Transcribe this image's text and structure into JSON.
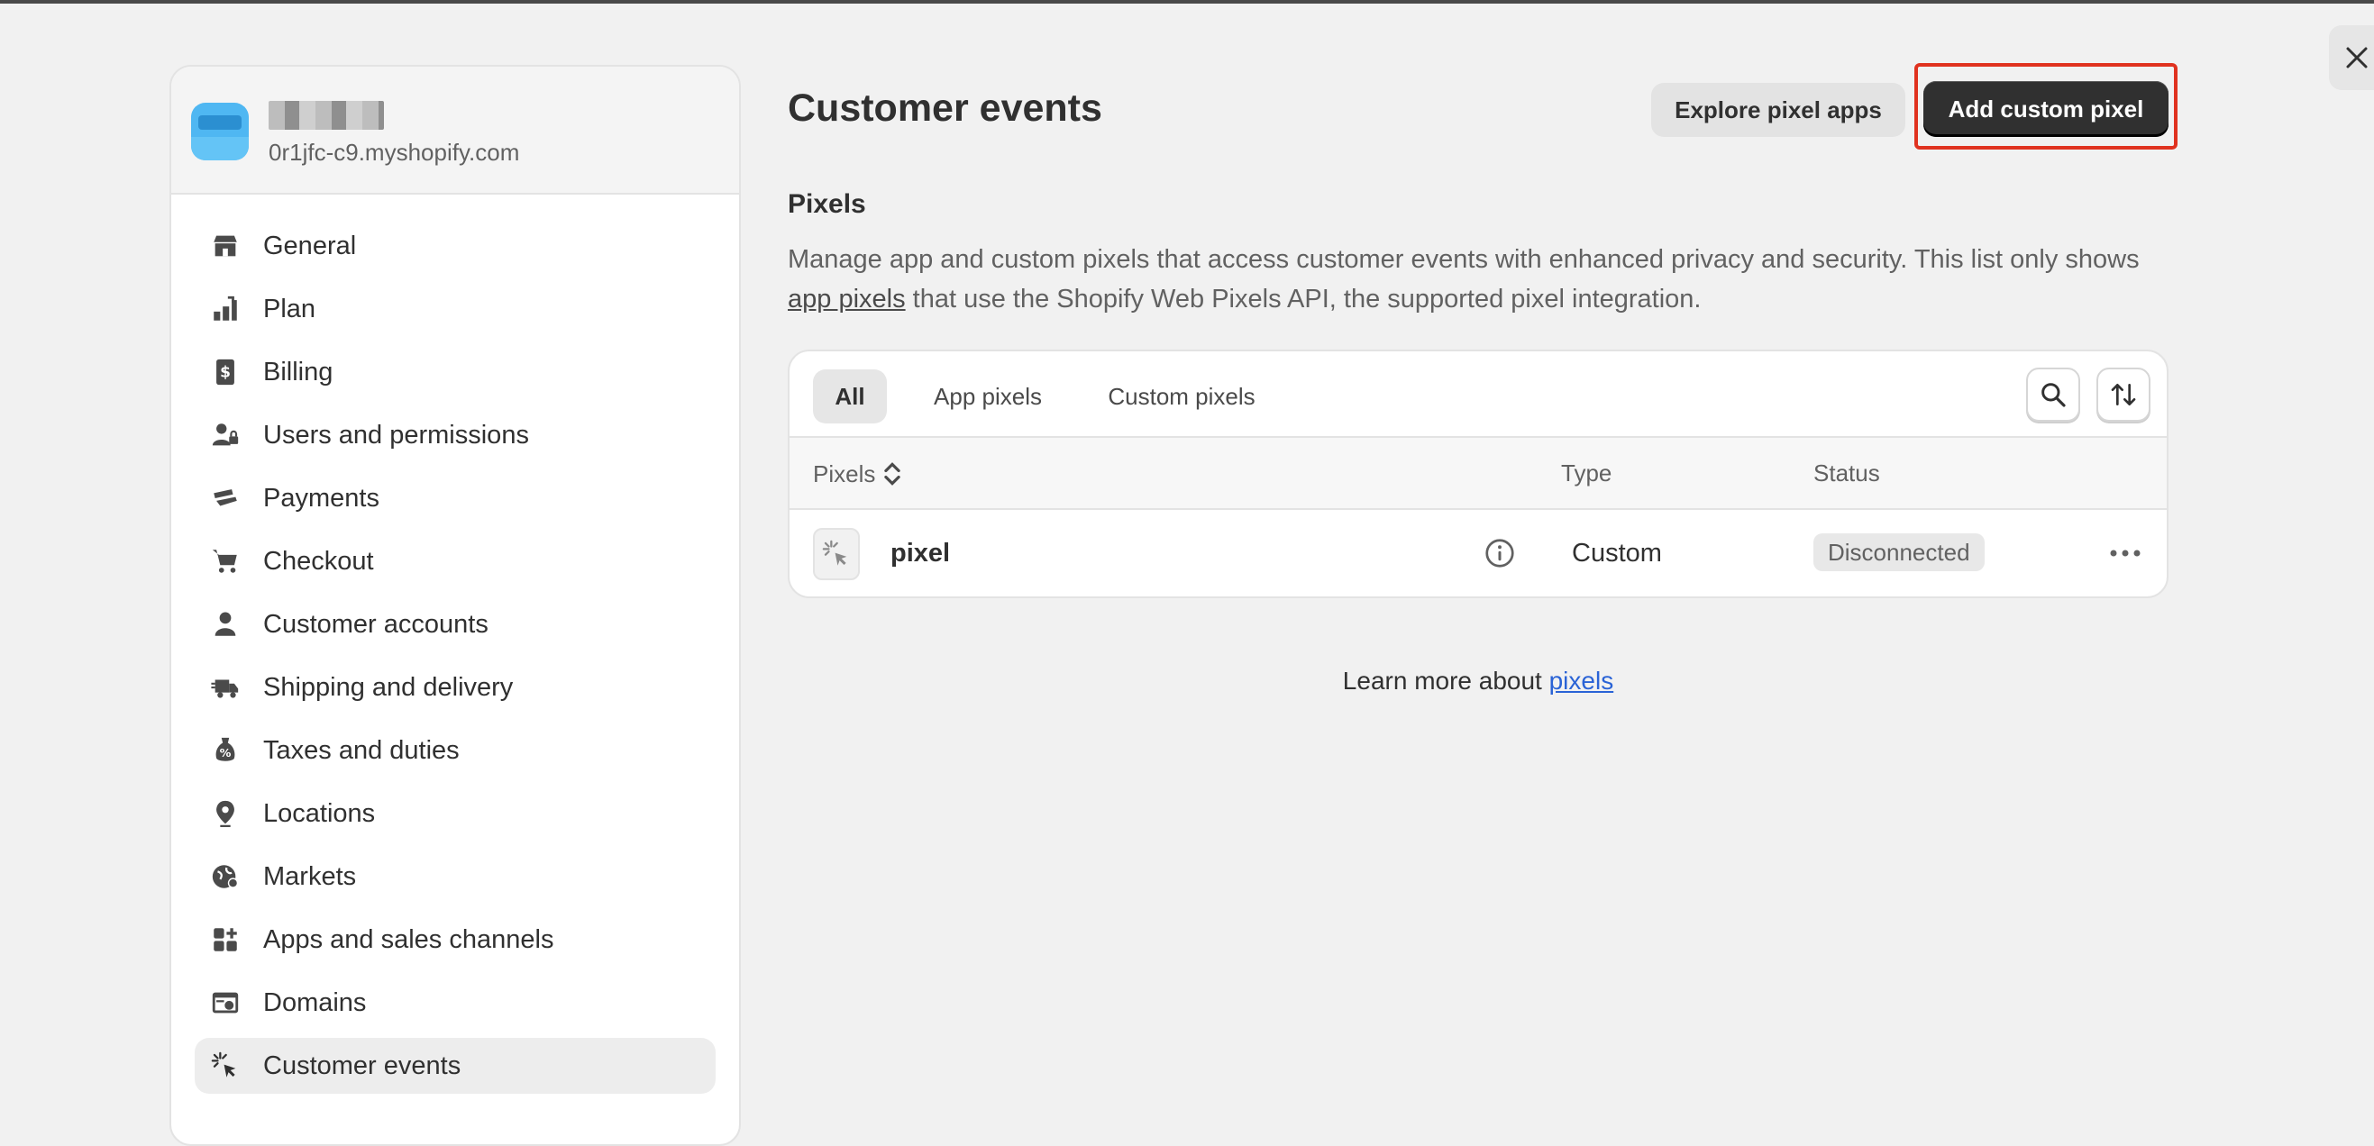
{
  "window": {
    "close_icon": "close-icon"
  },
  "store": {
    "name": "",
    "domain": "0r1jfc-c9.myshopify.com"
  },
  "sidebar": {
    "items": [
      {
        "label": "General",
        "icon": "store-icon",
        "active": false
      },
      {
        "label": "Plan",
        "icon": "plan-icon",
        "active": false
      },
      {
        "label": "Billing",
        "icon": "billing-icon",
        "active": false
      },
      {
        "label": "Users and permissions",
        "icon": "users-icon",
        "active": false
      },
      {
        "label": "Payments",
        "icon": "payments-icon",
        "active": false
      },
      {
        "label": "Checkout",
        "icon": "cart-icon",
        "active": false
      },
      {
        "label": "Customer accounts",
        "icon": "person-icon",
        "active": false
      },
      {
        "label": "Shipping and delivery",
        "icon": "truck-icon",
        "active": false
      },
      {
        "label": "Taxes and duties",
        "icon": "tax-icon",
        "active": false
      },
      {
        "label": "Locations",
        "icon": "location-pin-icon",
        "active": false
      },
      {
        "label": "Markets",
        "icon": "globe-icon",
        "active": false
      },
      {
        "label": "Apps and sales channels",
        "icon": "apps-icon",
        "active": false
      },
      {
        "label": "Domains",
        "icon": "domains-icon",
        "active": false
      },
      {
        "label": "Customer events",
        "icon": "cursor-click-icon",
        "active": true
      }
    ]
  },
  "main": {
    "title": "Customer events",
    "explore_button": "Explore pixel apps",
    "add_button": "Add custom pixel",
    "section_title": "Pixels",
    "description_before": "Manage app and custom pixels that access customer events with enhanced privacy and security. This list only shows ",
    "description_link": "app pixels",
    "description_after": " that use the Shopify Web Pixels API, the supported pixel integration.",
    "tabs": [
      {
        "label": "All",
        "active": true
      },
      {
        "label": "App pixels",
        "active": false
      },
      {
        "label": "Custom pixels",
        "active": false
      }
    ],
    "table": {
      "columns": [
        "Pixels",
        "Type",
        "Status"
      ],
      "rows": [
        {
          "name": "pixel",
          "type": "Custom",
          "status": "Disconnected"
        }
      ]
    },
    "learn_more_text": "Learn more about ",
    "learn_more_link": "pixels"
  },
  "colors": {
    "accent_dark": "#303030",
    "highlight": "#e0321f",
    "link": "#2a63d6",
    "avatar": "#4fb7f2"
  }
}
